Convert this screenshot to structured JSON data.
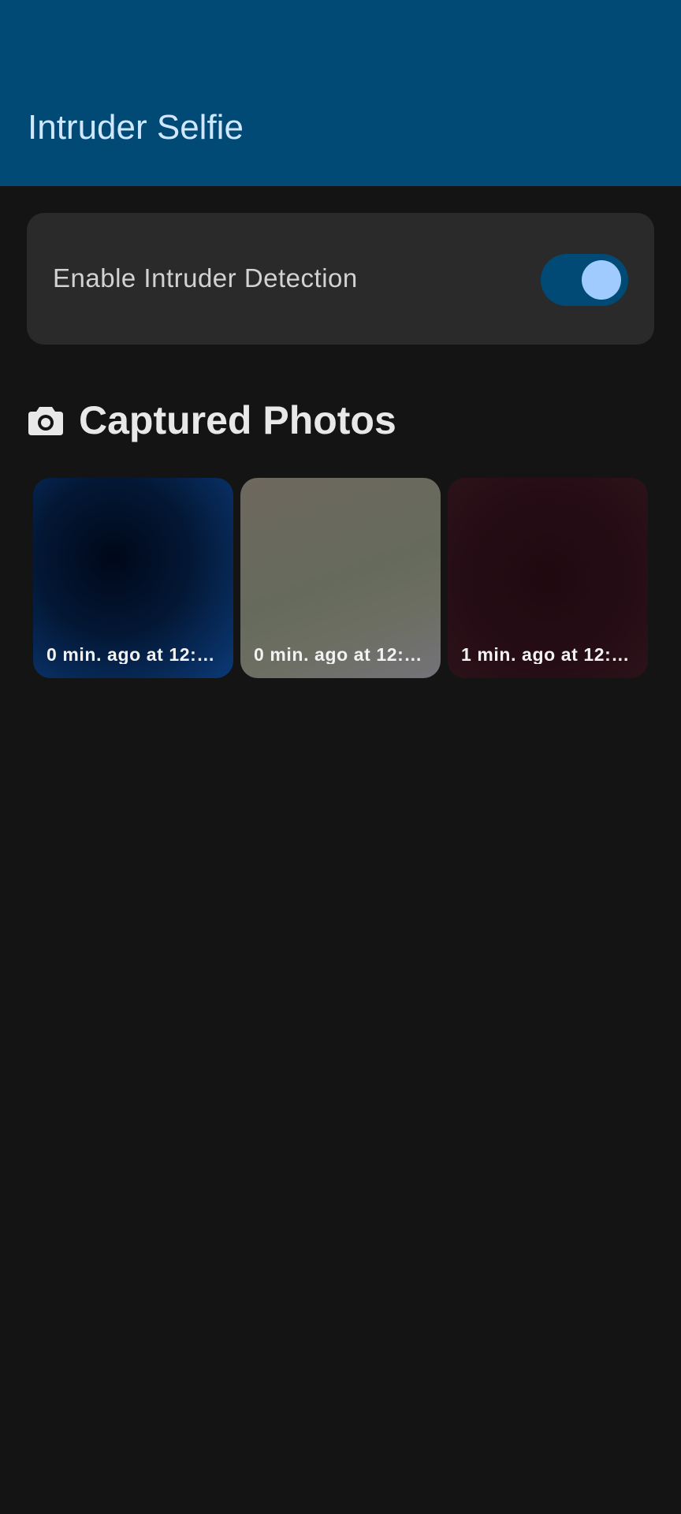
{
  "app_bar": {
    "title": "Intruder Selfie",
    "color": "#004a75"
  },
  "settings": {
    "intruder_detection": {
      "label": "Enable Intruder Detection",
      "enabled": true
    }
  },
  "captured": {
    "icon": "camera-icon",
    "title": "Captured Photos",
    "photos": [
      {
        "caption": "0 min. ago at 12:2…"
      },
      {
        "caption": "0 min. ago at 12:2…"
      },
      {
        "caption": "1 min. ago at 12:2…"
      }
    ]
  },
  "colors": {
    "background": "#141414",
    "card": "#2a2a2a",
    "accent": "#9fcbff"
  }
}
